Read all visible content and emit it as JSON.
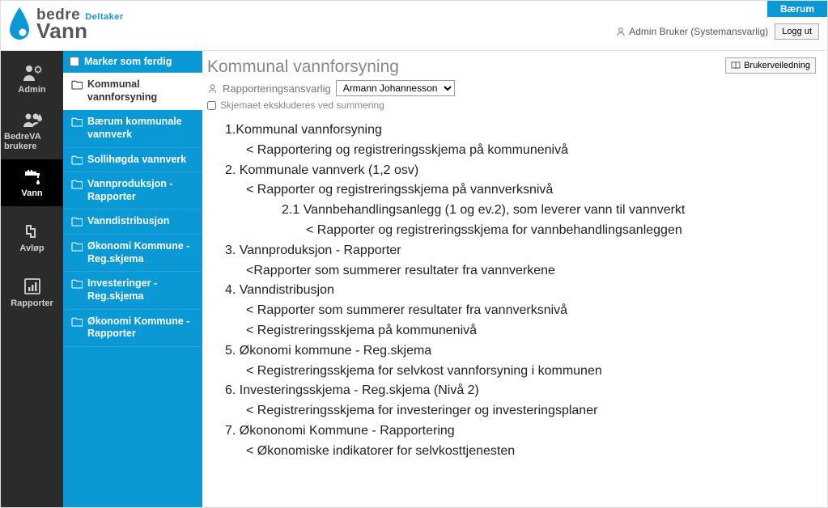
{
  "header": {
    "logo_top": "bedre",
    "logo_sub": "Deltaker",
    "logo_bottom": "Vann",
    "org": "Bærum",
    "user": "Admin Bruker (Systemansvarlig)",
    "logout": "Logg ut"
  },
  "rail": {
    "items": [
      {
        "name": "admin",
        "label": "Admin"
      },
      {
        "name": "bedreva-brukere",
        "label": "BedreVA brukere"
      },
      {
        "name": "vann",
        "label": "Vann",
        "active": true
      },
      {
        "name": "avlop",
        "label": "Avløp"
      },
      {
        "name": "rapporter",
        "label": "Rapporter"
      }
    ]
  },
  "col2": {
    "top_label": "Marker som ferdig",
    "items": [
      {
        "label": "Kommunal vannforsyning",
        "active": true
      },
      {
        "label": "Bærum kommunale vannverk"
      },
      {
        "label": "Sollihøgda vannverk"
      },
      {
        "label": "Vannproduksjon - Rapporter"
      },
      {
        "label": "Vanndistribusjon"
      },
      {
        "label": "Økonomi Kommune - Reg.skjema"
      },
      {
        "label": "Investeringer - Reg.skjema"
      },
      {
        "label": "Økonomi Kommune - Rapporter"
      }
    ]
  },
  "main": {
    "title": "Kommunal vannforsyning",
    "responsible_label": "Rapporteringsansvarlig",
    "responsible_value": "Armann Johannesson",
    "exclude_label": "Skjemaet ekskluderes ved summering",
    "guide_btn": "Brukerveiledning",
    "outline": [
      {
        "lvl": 1,
        "text": "1.Kommunal vannforsyning"
      },
      {
        "lvl": 2,
        "text": "< Rapportering og registreringsskjema på kommunenivå"
      },
      {
        "lvl": 1,
        "text": "2. Kommunale vannverk (1,2 osv)"
      },
      {
        "lvl": 2,
        "text": "< Rapporter og registreringsskjema på vannverksnivå"
      },
      {
        "lvl": 3,
        "text": "2.1 Vannbehandlingsanlegg (1 og ev.2), som leverer vann til vannverkt"
      },
      {
        "lvl": 4,
        "text": "< Rapporter og registreringsskjema for vannbehandlingsanleggen"
      },
      {
        "lvl": 1,
        "text": "3. Vannproduksjon - Rapporter"
      },
      {
        "lvl": 2,
        "text": "<Rapporter som summerer resultater fra vannverkene"
      },
      {
        "lvl": 1,
        "text": "4. Vanndistribusjon"
      },
      {
        "lvl": 2,
        "text": "< Rapporter som summerer resultater fra vannverksnivå"
      },
      {
        "lvl": 2,
        "text": "< Registreringsskjema på kommunenivå"
      },
      {
        "lvl": 1,
        "text": "5. Økonomi kommune - Reg.skjema"
      },
      {
        "lvl": 2,
        "text": "< Registreringsskjema for selvkost vannforsyning i kommunen"
      },
      {
        "lvl": 1,
        "text": "6. Investeringsskjema - Reg.skjema (Nivå 2)"
      },
      {
        "lvl": 2,
        "text": "< Registreringsskjema for investeringer og investeringsplaner"
      },
      {
        "lvl": 1,
        "text": "7. Økononomi Kommune - Rapportering"
      },
      {
        "lvl": 2,
        "text": "< Økonomiske indikatorer for selvkosttjenesten"
      }
    ]
  }
}
